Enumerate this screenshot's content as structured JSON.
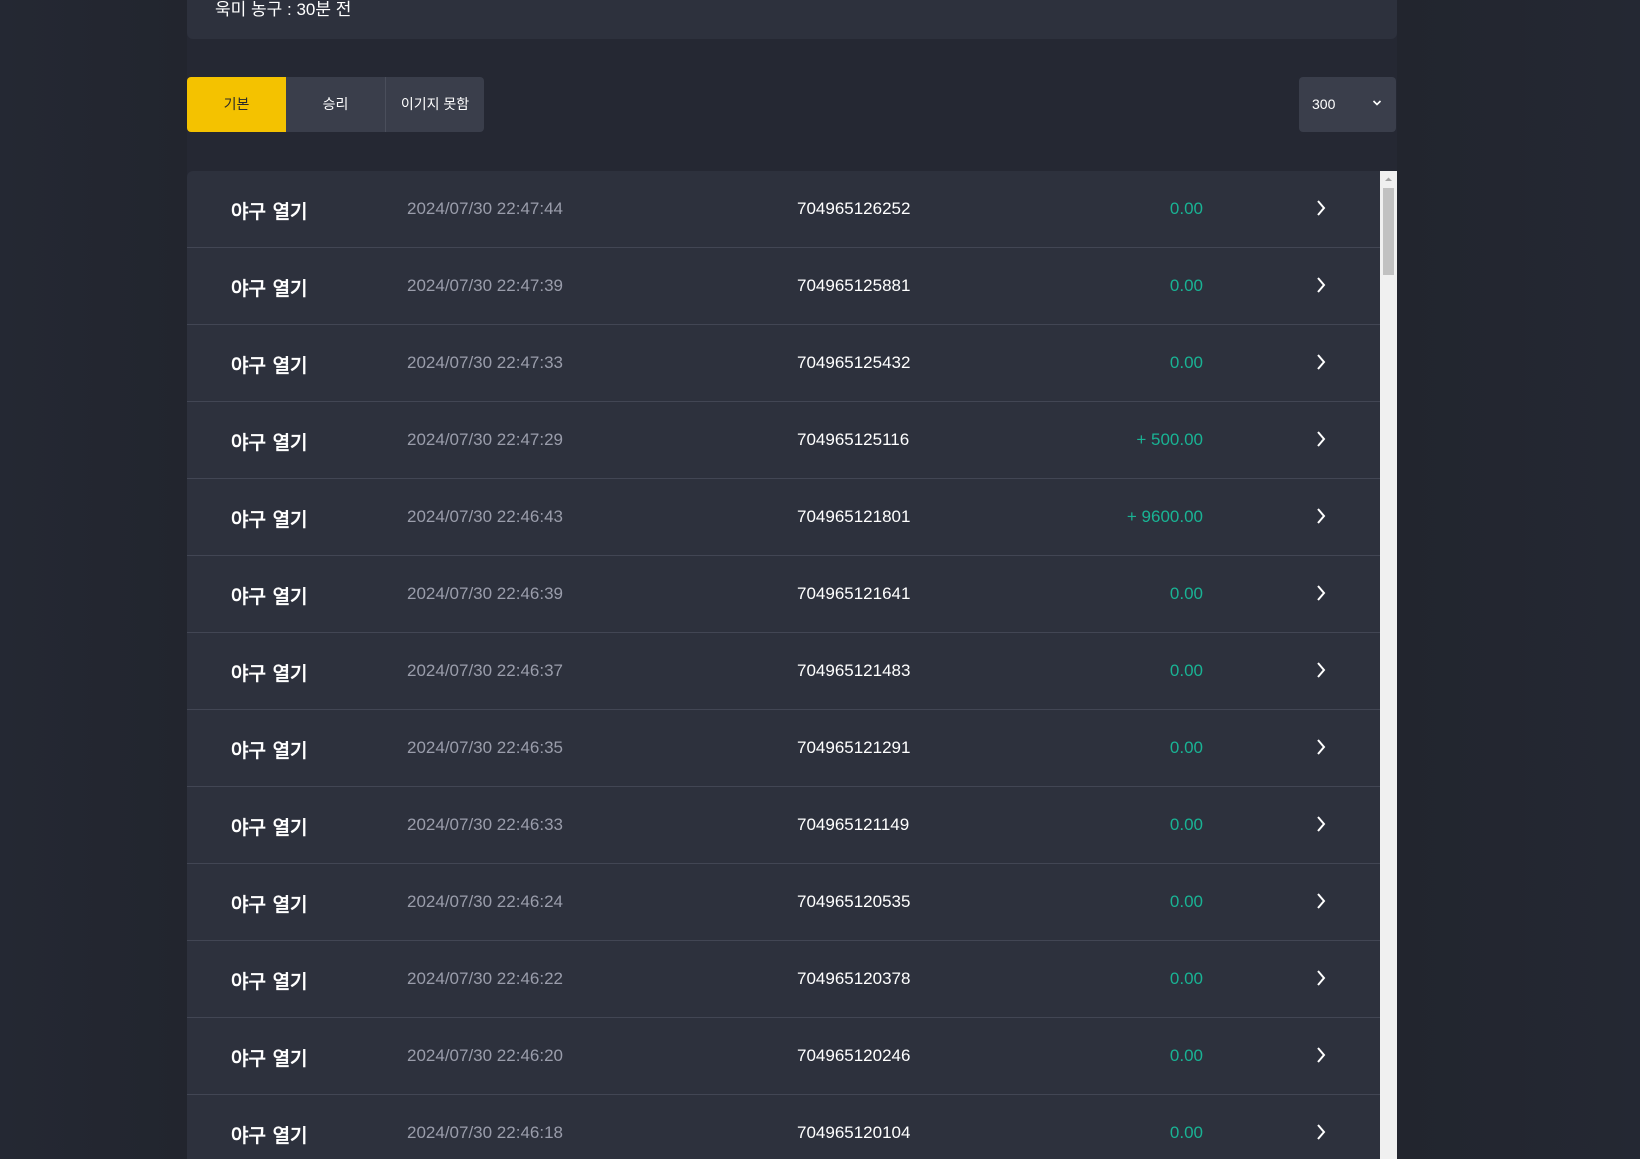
{
  "header": {
    "text": "욱미 농구 : 30분 전"
  },
  "tabs": [
    {
      "label": "기본",
      "active": true
    },
    {
      "label": "승리",
      "active": false
    },
    {
      "label": "이기지 못함",
      "active": false
    }
  ],
  "page_size_select": {
    "value": "300"
  },
  "colors": {
    "accent": "#f4c200",
    "positive": "#19b394",
    "background": "#252833",
    "row": "#2d313d"
  },
  "rows": [
    {
      "game": "야구 열기",
      "time": "2024/07/30 22:47:44",
      "id": "704965126252",
      "amount": "0.00"
    },
    {
      "game": "야구 열기",
      "time": "2024/07/30 22:47:39",
      "id": "704965125881",
      "amount": "0.00"
    },
    {
      "game": "야구 열기",
      "time": "2024/07/30 22:47:33",
      "id": "704965125432",
      "amount": "0.00"
    },
    {
      "game": "야구 열기",
      "time": "2024/07/30 22:47:29",
      "id": "704965125116",
      "amount": "+ 500.00"
    },
    {
      "game": "야구 열기",
      "time": "2024/07/30 22:46:43",
      "id": "704965121801",
      "amount": "+ 9600.00"
    },
    {
      "game": "야구 열기",
      "time": "2024/07/30 22:46:39",
      "id": "704965121641",
      "amount": "0.00"
    },
    {
      "game": "야구 열기",
      "time": "2024/07/30 22:46:37",
      "id": "704965121483",
      "amount": "0.00"
    },
    {
      "game": "야구 열기",
      "time": "2024/07/30 22:46:35",
      "id": "704965121291",
      "amount": "0.00"
    },
    {
      "game": "야구 열기",
      "time": "2024/07/30 22:46:33",
      "id": "704965121149",
      "amount": "0.00"
    },
    {
      "game": "야구 열기",
      "time": "2024/07/30 22:46:24",
      "id": "704965120535",
      "amount": "0.00"
    },
    {
      "game": "야구 열기",
      "time": "2024/07/30 22:46:22",
      "id": "704965120378",
      "amount": "0.00"
    },
    {
      "game": "야구 열기",
      "time": "2024/07/30 22:46:20",
      "id": "704965120246",
      "amount": "0.00"
    },
    {
      "game": "야구 열기",
      "time": "2024/07/30 22:46:18",
      "id": "704965120104",
      "amount": "0.00"
    }
  ]
}
